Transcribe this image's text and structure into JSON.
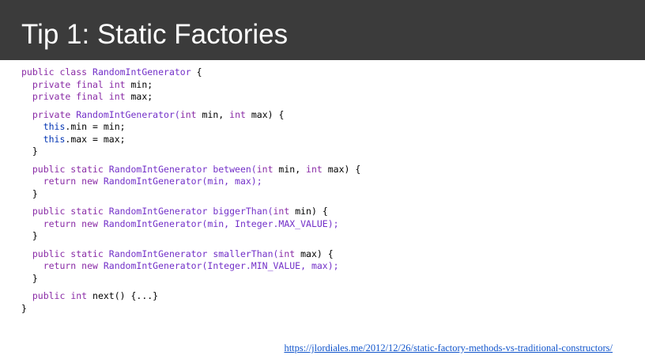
{
  "slide": {
    "title": "Tip 1: Static Factories",
    "source_url": "https://jlordiales.me/2012/12/26/static-factory-methods-vs-traditional-constructors/"
  },
  "colors": {
    "title_bar": "#3b3b3b",
    "title_text": "#ffffff",
    "keyword": "#8a2ca6",
    "method_name": "#7330c8",
    "this_keyword": "#0033b3",
    "link": "#1155cc"
  },
  "code": {
    "language": "java",
    "lines": [
      [
        {
          "t": "public class ",
          "c": "kw"
        },
        {
          "t": "RandomIntGenerator",
          "c": "fn"
        },
        {
          "t": " {",
          "c": ""
        }
      ],
      [
        {
          "t": "  private final int ",
          "c": "kw"
        },
        {
          "t": "min;",
          "c": ""
        }
      ],
      [
        {
          "t": "  private final int ",
          "c": "kw"
        },
        {
          "t": "max;",
          "c": ""
        }
      ],
      [
        {
          "t": "  private ",
          "c": "kw"
        },
        {
          "t": "RandomIntGenerator(",
          "c": "fn"
        },
        {
          "t": "int",
          "c": "kw"
        },
        {
          "t": " min, ",
          "c": ""
        },
        {
          "t": "int",
          "c": "kw"
        },
        {
          "t": " max) {",
          "c": ""
        }
      ],
      [
        {
          "t": "    ",
          "c": ""
        },
        {
          "t": "this",
          "c": "this"
        },
        {
          "t": ".min = min;",
          "c": ""
        }
      ],
      [
        {
          "t": "    ",
          "c": ""
        },
        {
          "t": "this",
          "c": "this"
        },
        {
          "t": ".max = max;",
          "c": ""
        }
      ],
      [
        {
          "t": "  }",
          "c": ""
        }
      ],
      [
        {
          "t": "  public static ",
          "c": "kw"
        },
        {
          "t": "RandomIntGenerator between(",
          "c": "fn"
        },
        {
          "t": "int",
          "c": "kw"
        },
        {
          "t": " min, ",
          "c": ""
        },
        {
          "t": "int",
          "c": "kw"
        },
        {
          "t": " max) {",
          "c": ""
        }
      ],
      [
        {
          "t": "    return new ",
          "c": "kw"
        },
        {
          "t": "RandomIntGenerator(min, max);",
          "c": "fn"
        }
      ],
      [
        {
          "t": "  }",
          "c": ""
        }
      ],
      [
        {
          "t": "  public static ",
          "c": "kw"
        },
        {
          "t": "RandomIntGenerator biggerThan(",
          "c": "fn"
        },
        {
          "t": "int",
          "c": "kw"
        },
        {
          "t": " min) {",
          "c": ""
        }
      ],
      [
        {
          "t": "    return new ",
          "c": "kw"
        },
        {
          "t": "RandomIntGenerator(min, Integer.MAX_VALUE);",
          "c": "fn"
        }
      ],
      [
        {
          "t": "  }",
          "c": ""
        }
      ],
      [
        {
          "t": "  public static ",
          "c": "kw"
        },
        {
          "t": "RandomIntGenerator smallerThan(",
          "c": "fn"
        },
        {
          "t": "int",
          "c": "kw"
        },
        {
          "t": " max) {",
          "c": ""
        }
      ],
      [
        {
          "t": "    return new ",
          "c": "kw"
        },
        {
          "t": "RandomIntGenerator(Integer.MIN_VALUE, max);",
          "c": "fn"
        }
      ],
      [
        {
          "t": "  }",
          "c": ""
        }
      ],
      [
        {
          "t": "  public ",
          "c": "kw"
        },
        {
          "t": "int",
          "c": "kw"
        },
        {
          "t": " next() {...}",
          "c": ""
        }
      ],
      [
        {
          "t": "}",
          "c": ""
        }
      ]
    ]
  }
}
